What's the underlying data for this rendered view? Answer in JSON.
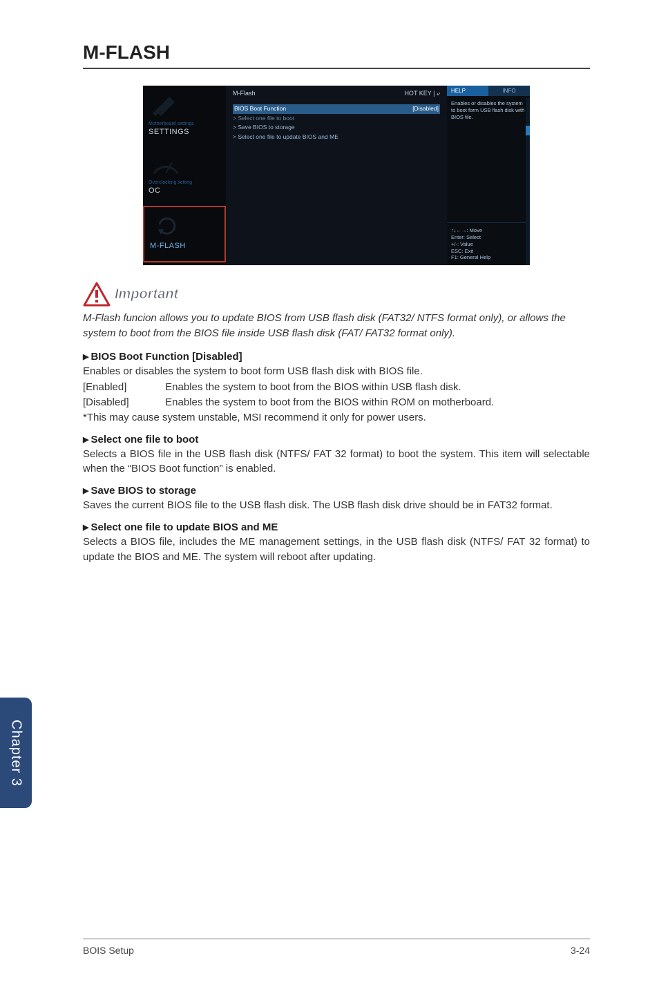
{
  "title": "M-FLASH",
  "bios": {
    "header_left": "M-Flash",
    "header_right": "HOT KEY | ⤶",
    "rows": [
      {
        "label": "BIOS Boot Function",
        "value": "[Disabled]",
        "cls": "hl"
      },
      {
        "label": "> Select one file to boot",
        "value": "",
        "cls": "dim"
      },
      {
        "label": "> Save BIOS to storage",
        "value": "",
        "cls": ""
      },
      {
        "label": "> Select one file to update BIOS and ME",
        "value": "",
        "cls": ""
      }
    ],
    "left": {
      "settings_sub": "Motherboard settings",
      "settings": "SETTINGS",
      "oc_sub": "Overclocking setting",
      "oc": "OC",
      "mflash": "M-FLASH"
    },
    "tabs": {
      "help": "HELP",
      "info": "INFO"
    },
    "help_text": "Enables or disables the system to boot form USB flash disk with BIOS file.",
    "keyhelp": "↑↓←→: Move\nEnter: Select\n+/-: Value\nESC: Exit\nF1: General Help"
  },
  "important_label": "Important",
  "important_para": "M-Flash funcion allows you to update BIOS from USB flash disk (FAT32/ NTFS format only), or allows the system to boot from the BIOS file inside USB flash disk (FAT/ FAT32 format only).",
  "items": {
    "bios_boot": {
      "heading": "BIOS Boot Function [Disabled]",
      "l1": "Enables or disables the system to boot form USB flash disk with BIOS file.",
      "opt_enabled_k": "[Enabled]",
      "opt_enabled_v": "Enables the system to boot from the BIOS within USB flash disk.",
      "opt_disabled_k": "[Disabled]",
      "opt_disabled_v": "Enables the system to boot from the BIOS within ROM on motherboard.",
      "note": "*This may cause system unstable, MSI recommend it only for power users."
    },
    "select_boot": {
      "heading": "Select one file to boot",
      "body": "Selects a BIOS file in the USB flash disk (NTFS/ FAT 32 format) to boot the system. This item will selectable when the “BIOS Boot function” is enabled."
    },
    "save_bios": {
      "heading": "Save BIOS to storage",
      "body": "Saves the current BIOS file to the USB flash disk. The USB flash disk drive should be in FAT32 format."
    },
    "select_update": {
      "heading": "Select one file to update BIOS and ME",
      "body": "Selects a BIOS file, includes the ME management settings, in the USB flash disk (NTFS/ FAT 32 format) to update the BIOS and ME. The system will reboot after updating."
    }
  },
  "side_tab": "Chapter 3",
  "footer_left": "BOIS Setup",
  "footer_right": "3-24"
}
